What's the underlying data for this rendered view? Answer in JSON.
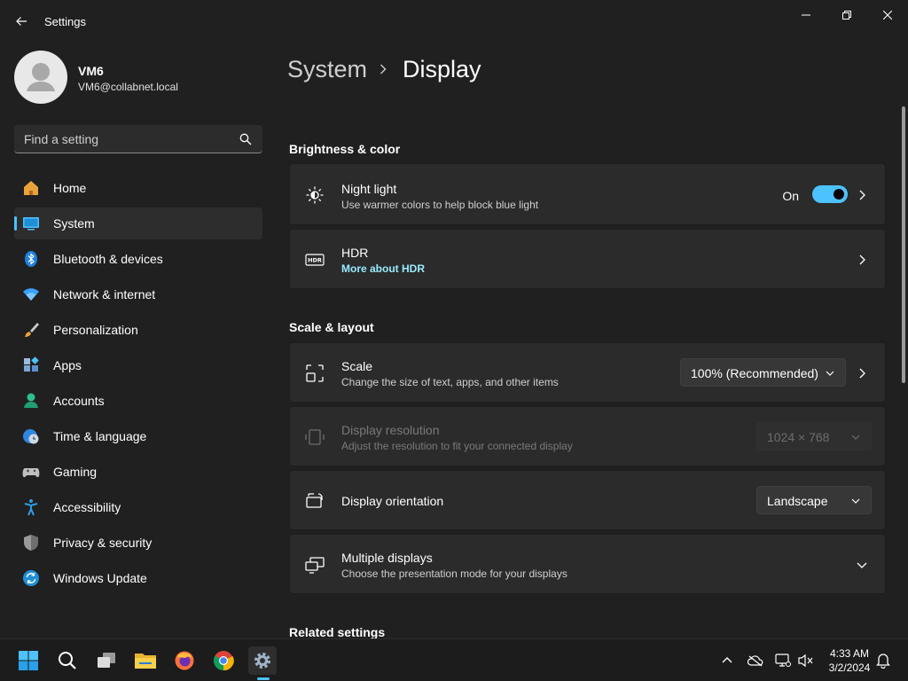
{
  "window": {
    "title": "Settings",
    "back_icon": "back-arrow-icon",
    "controls": [
      "minimize-icon",
      "restore-icon",
      "close-icon"
    ]
  },
  "profile": {
    "name": "VM6",
    "email": "VM6@collabnet.local"
  },
  "search": {
    "placeholder": "Find a setting"
  },
  "sidebar": {
    "items": [
      {
        "label": "Home",
        "icon": "home-icon"
      },
      {
        "label": "System",
        "icon": "system-icon",
        "selected": true
      },
      {
        "label": "Bluetooth & devices",
        "icon": "bluetooth-icon"
      },
      {
        "label": "Network & internet",
        "icon": "wifi-icon"
      },
      {
        "label": "Personalization",
        "icon": "brush-icon"
      },
      {
        "label": "Apps",
        "icon": "apps-icon"
      },
      {
        "label": "Accounts",
        "icon": "accounts-icon"
      },
      {
        "label": "Time & language",
        "icon": "globe-clock-icon"
      },
      {
        "label": "Gaming",
        "icon": "gamepad-icon"
      },
      {
        "label": "Accessibility",
        "icon": "accessibility-icon"
      },
      {
        "label": "Privacy & security",
        "icon": "shield-icon"
      },
      {
        "label": "Windows Update",
        "icon": "update-icon"
      }
    ]
  },
  "breadcrumb": {
    "parent": "System",
    "current": "Display"
  },
  "sections": {
    "brightness": "Brightness & color",
    "scale": "Scale & layout",
    "related": "Related settings"
  },
  "cards": {
    "night_light": {
      "title": "Night light",
      "subtitle": "Use warmer colors to help block blue light",
      "toggle_label": "On",
      "toggle_on": true
    },
    "hdr": {
      "title": "HDR",
      "link": "More about HDR"
    },
    "scale": {
      "title": "Scale",
      "subtitle": "Change the size of text, apps, and other items",
      "value": "100% (Recommended)"
    },
    "resolution": {
      "title": "Display resolution",
      "subtitle": "Adjust the resolution to fit your connected display",
      "value": "1024 × 768",
      "disabled": true
    },
    "orientation": {
      "title": "Display orientation",
      "value": "Landscape"
    },
    "multiple": {
      "title": "Multiple displays",
      "subtitle": "Choose the presentation mode for your displays"
    }
  },
  "taskbar": {
    "apps": [
      "start-icon",
      "search-icon",
      "task-view-icon",
      "file-explorer-icon",
      "firefox-icon",
      "chrome-icon",
      "settings-icon"
    ],
    "tray": [
      "chevron-up-icon",
      "onedrive-icon",
      "network-icon",
      "volume-muted-icon",
      "notifications-icon"
    ],
    "time": "4:33 AM",
    "date": "3/2/2024"
  },
  "colors": {
    "accent": "#4cc2ff",
    "background": "#202020",
    "card": "#2b2b2b",
    "link": "#99ebff"
  }
}
